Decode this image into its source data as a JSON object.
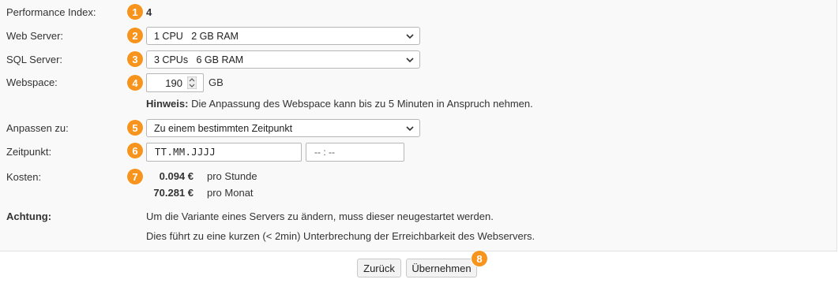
{
  "fields": {
    "performance_index": {
      "label": "Performance Index:",
      "value": "4",
      "badge": "1"
    },
    "web_server": {
      "label": "Web Server:",
      "value": "1 CPU   2 GB RAM",
      "badge": "2"
    },
    "sql_server": {
      "label": "SQL Server:",
      "value": "3 CPUs   6 GB RAM",
      "badge": "3"
    },
    "webspace": {
      "label": "Webspace:",
      "value": "190",
      "unit": "GB",
      "badge": "4",
      "hint_bold": "Hinweis:",
      "hint_text": " Die Anpassung des Webspace kann bis zu 5 Minuten in Anspruch nehmen."
    },
    "adjust_to": {
      "label": "Anpassen zu:",
      "value": "Zu einem bestimmten Zeitpunkt",
      "badge": "5"
    },
    "timepoint": {
      "label": "Zeitpunkt:",
      "date_placeholder": "TT.MM.JJJJ",
      "time_placeholder": "-- : --",
      "badge": "6"
    },
    "costs": {
      "label": "Kosten:",
      "badge": "7",
      "rows": [
        {
          "amount": "0.094 €",
          "unit": "pro Stunde"
        },
        {
          "amount": "70.281 €",
          "unit": "pro Monat"
        }
      ]
    },
    "warning": {
      "label": "Achtung:",
      "line1": "Um die Variante eines Servers zu ändern, muss dieser neugestartet werden.",
      "line2": "Dies führt zu eine kurzen (< 2min) Unterbrechung der Erreichbarkeit des Webservers."
    }
  },
  "buttons": {
    "back": "Zurück",
    "apply": "Übernehmen",
    "apply_badge": "8"
  },
  "colors": {
    "badge": "#f7941d",
    "panel": "#f9f9f9"
  },
  "icons": {
    "select": "chevron-down-icon",
    "stepper": "stepper-icon"
  }
}
